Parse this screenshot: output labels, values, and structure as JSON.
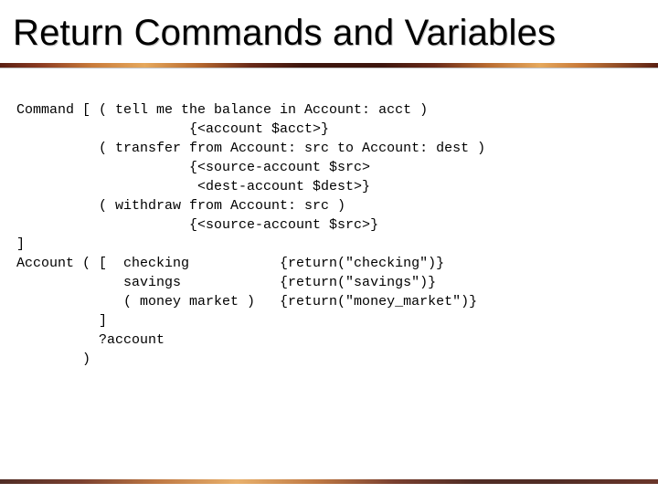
{
  "title": "Return Commands and Variables",
  "code": "Command [ ( tell me the balance in Account: acct )\n                     {<account $acct>}\n          ( transfer from Account: src to Account: dest )\n                     {<source-account $src>\n                      <dest-account $dest>}\n          ( withdraw from Account: src )\n                     {<source-account $src>}\n]\nAccount ( [  checking           {return(\"checking\")}\n             savings            {return(\"savings\")}\n             ( money market )   {return(\"money_market\")}\n          ]\n          ?account\n        )"
}
